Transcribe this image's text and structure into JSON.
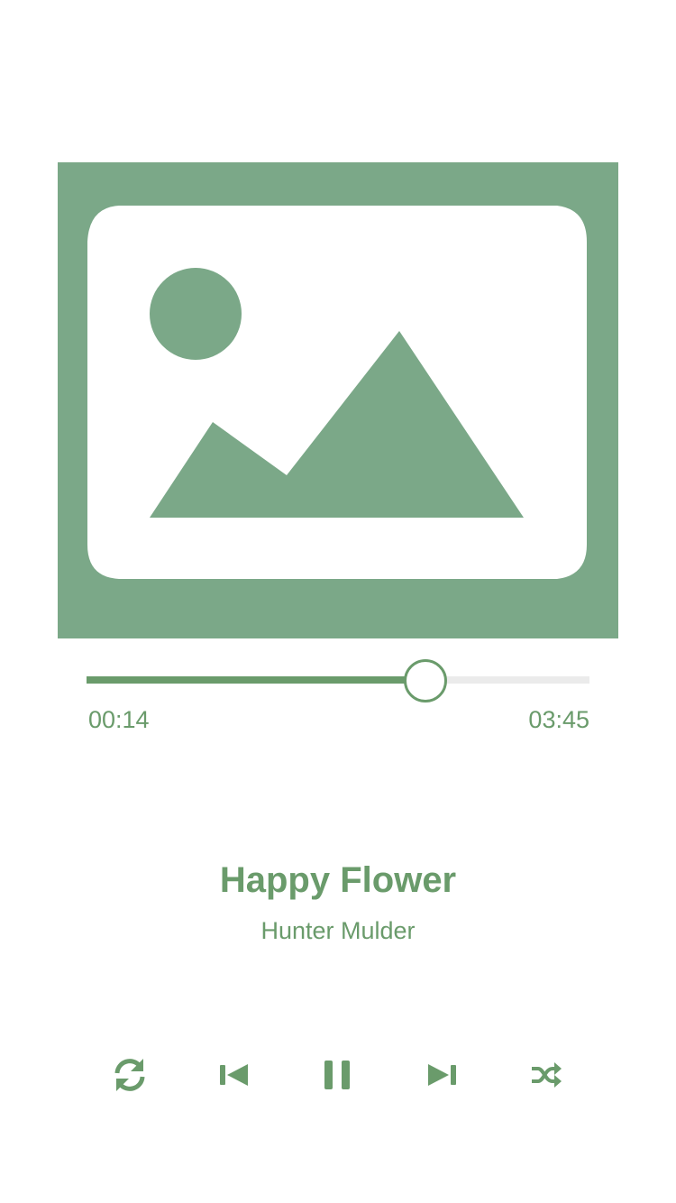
{
  "colors": {
    "accent": "#6a9b6b",
    "cover_bg": "#7ba888",
    "track": "#ebebeb",
    "background": "#ffffff"
  },
  "cover": {
    "icon": "image-placeholder-icon"
  },
  "player": {
    "elapsed": "00:14",
    "duration": "03:45",
    "progress_fraction": 0.669
  },
  "track": {
    "title": "Happy Flower",
    "artist": "Hunter Mulder"
  },
  "controls": [
    {
      "name": "repeat",
      "icon": "repeat-icon"
    },
    {
      "name": "previous",
      "icon": "skip-previous-icon"
    },
    {
      "name": "pause",
      "icon": "pause-icon"
    },
    {
      "name": "next",
      "icon": "skip-next-icon"
    },
    {
      "name": "shuffle",
      "icon": "shuffle-icon"
    }
  ]
}
